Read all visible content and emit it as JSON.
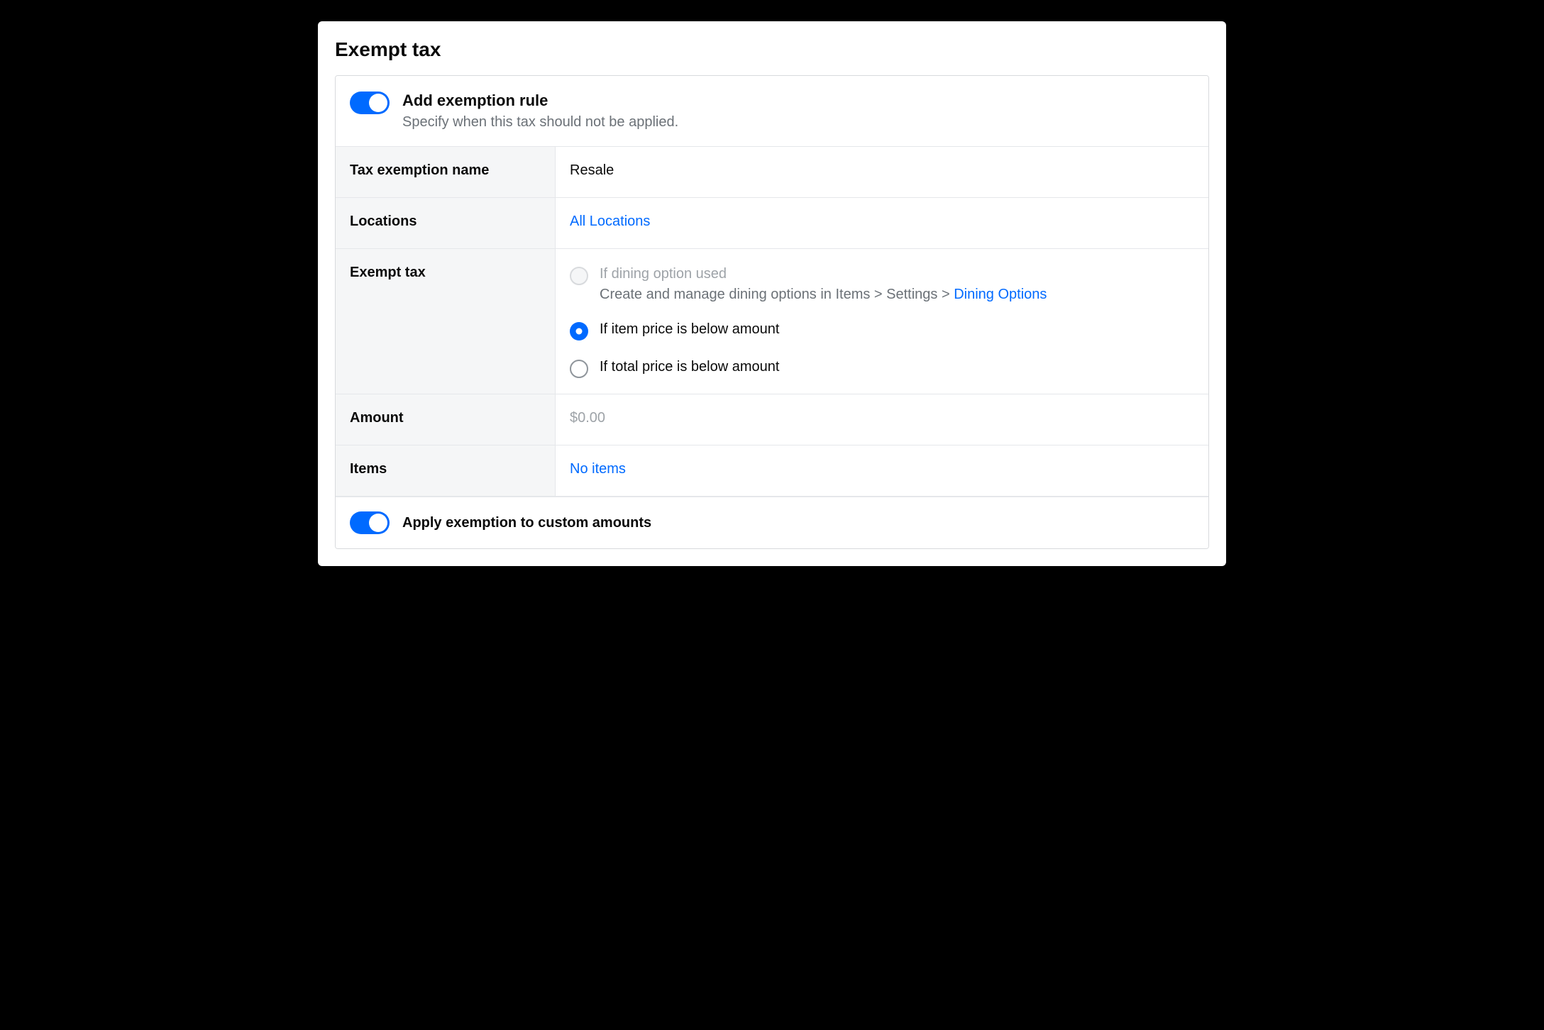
{
  "page_title": "Exempt tax",
  "add_rule": {
    "toggle_on": true,
    "title": "Add exemption rule",
    "subtitle": "Specify when this tax should not be applied."
  },
  "fields": {
    "name": {
      "label": "Tax exemption name",
      "value": "Resale"
    },
    "locations": {
      "label": "Locations",
      "value": "All Locations"
    },
    "exempt_tax": {
      "label": "Exempt tax",
      "options": {
        "dining": {
          "label": "If dining option used",
          "help_prefix": "Create and manage dining options in Items > Settings > ",
          "help_link": "Dining Options"
        },
        "item_below": {
          "label": "If item price is below amount"
        },
        "total_below": {
          "label": "If total price is below amount"
        }
      }
    },
    "amount": {
      "label": "Amount",
      "placeholder": "$0.00"
    },
    "items": {
      "label": "Items",
      "value": "No items"
    }
  },
  "footer": {
    "toggle_on": true,
    "label": "Apply exemption to custom amounts"
  }
}
